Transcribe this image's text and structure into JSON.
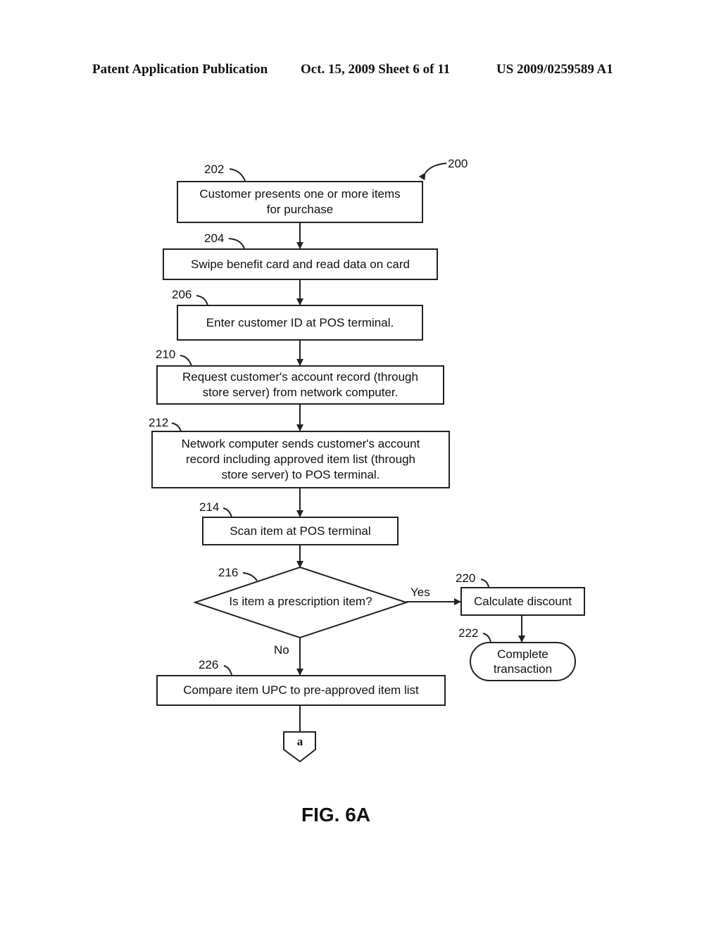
{
  "header": {
    "publication": "Patent Application Publication",
    "date_sheet": "Oct. 15, 2009   Sheet 6 of 11",
    "number": "US 2009/0259589 A1"
  },
  "figure": {
    "ref": "200",
    "label": "FIG. 6A"
  },
  "steps": [
    {
      "ref": "202",
      "text_lines": [
        "Customer presents one or more items",
        "for purchase"
      ]
    },
    {
      "ref": "204",
      "text": "Swipe benefit card and read data on card"
    },
    {
      "ref": "206",
      "text": "Enter customer ID at POS terminal."
    },
    {
      "ref": "210",
      "text_lines": [
        "Request customer's account record (through",
        "store server) from network computer."
      ]
    },
    {
      "ref": "212",
      "text_lines": [
        "Network computer sends customer's account",
        "record including approved item list (through",
        "store server) to POS terminal."
      ]
    },
    {
      "ref": "214",
      "text": "Scan item at POS terminal"
    },
    {
      "ref": "216",
      "text": "Is item a prescription item?"
    },
    {
      "ref": "220",
      "text": "Calculate discount"
    },
    {
      "ref": "222",
      "text_lines": [
        "Complete",
        "transaction"
      ]
    },
    {
      "ref": "226",
      "text": "Compare item UPC to pre-approved item list"
    }
  ],
  "branches": {
    "yes": "Yes",
    "no": "No"
  },
  "connector": {
    "label": "a"
  }
}
